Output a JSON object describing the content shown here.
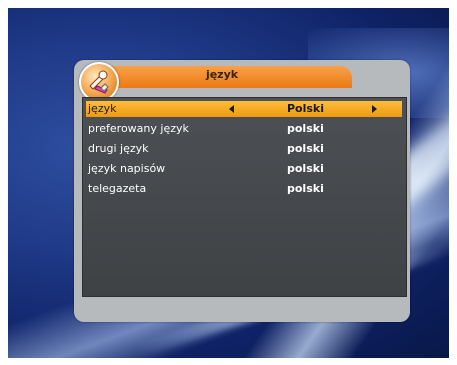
{
  "dialog": {
    "title": "język",
    "icon": "tools-icon"
  },
  "settings": [
    {
      "label": "język",
      "value": "Polski",
      "selected": true
    },
    {
      "label": "preferowany język",
      "value": "polski",
      "selected": false
    },
    {
      "label": "drugi język",
      "value": "polski",
      "selected": false
    },
    {
      "label": "język napisów",
      "value": "polski",
      "selected": false
    },
    {
      "label": "telegazeta",
      "value": "polski",
      "selected": false
    }
  ],
  "colors": {
    "accent": "#ec7a14",
    "highlight": "#f5a622",
    "panel": "#46494c",
    "frame": "#b7babc"
  }
}
